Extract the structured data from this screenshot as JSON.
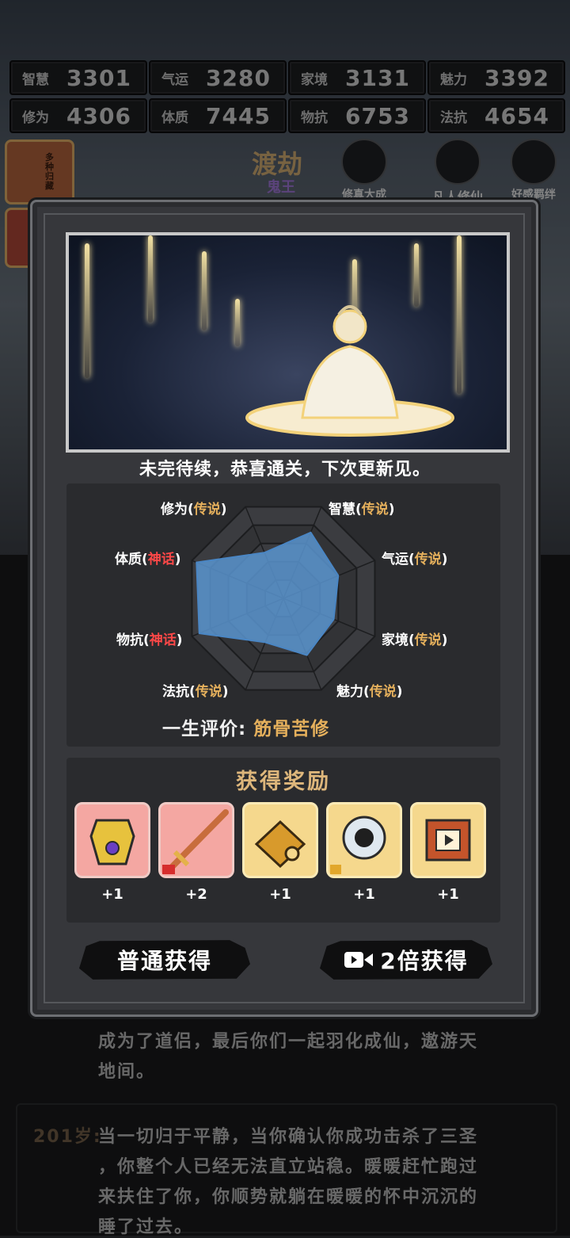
{
  "stats": [
    {
      "label": "智慧",
      "value": "3301"
    },
    {
      "label": "气运",
      "value": "3280"
    },
    {
      "label": "家境",
      "value": "3131"
    },
    {
      "label": "魅力",
      "value": "3392"
    },
    {
      "label": "修为",
      "value": "4306"
    },
    {
      "label": "体质",
      "value": "7445"
    },
    {
      "label": "物抗",
      "value": "6753"
    },
    {
      "label": "法抗",
      "value": "4654"
    }
  ],
  "realm": {
    "title": "渡劫",
    "subtitle": "鬼王"
  },
  "top_icons": {
    "cultivation": "修真大成",
    "mortal": "凡人修仙",
    "affinity": "好感羁绊"
  },
  "book_label": "多种归藏",
  "log": {
    "line1": "成为了道侣，最后你们一起羽化成仙，遨游天",
    "line2": "地间。",
    "age": "201岁:",
    "line3": "当一切归于平静，当你确认你成功击杀了三圣",
    "line4": "，你整个人已经无法直立站稳。暖暖赶忙跑过",
    "line5": "来扶住了你，你顺势就躺在暖暖的怀中沉沉的",
    "line6": "睡了过去。"
  },
  "modal": {
    "caption": "未完待续，恭喜通关，下次更新见。",
    "radar_labels": {
      "xiuwei": {
        "name": "修为",
        "level": "传说"
      },
      "zhihui": {
        "name": "智慧",
        "level": "传说"
      },
      "qiyun": {
        "name": "气运",
        "level": "传说"
      },
      "jiajing": {
        "name": "家境",
        "level": "传说"
      },
      "meili": {
        "name": "魅力",
        "level": "传说"
      },
      "fakang": {
        "name": "法抗",
        "level": "传说"
      },
      "wukang": {
        "name": "物抗",
        "level": "神话"
      },
      "tizhi": {
        "name": "体质",
        "level": "神话"
      }
    },
    "radar_values": {
      "zhihui": 0.72,
      "qiyun": 0.6,
      "jiajing": 0.55,
      "meili": 0.62,
      "fakang": 0.48,
      "wukang": 0.92,
      "tizhi": 0.95,
      "xiuwei": 0.5
    },
    "eval_label": "一生评价:",
    "eval_value": "筋骨苦修",
    "reward_title": "获得奖励",
    "rewards": [
      {
        "icon": "golden-armor-icon",
        "qty": "+1",
        "color": "pink"
      },
      {
        "icon": "sword-fragment-icon",
        "qty": "+2",
        "color": "pink"
      },
      {
        "icon": "puzzle-piece-icon",
        "qty": "+1",
        "color": "gold"
      },
      {
        "icon": "orb-fragment-icon",
        "qty": "+1",
        "color": "gold"
      },
      {
        "icon": "video-scroll-icon",
        "qty": "+1",
        "color": "gold"
      }
    ],
    "btn_normal": "普通获得",
    "btn_double": "2倍获得"
  }
}
